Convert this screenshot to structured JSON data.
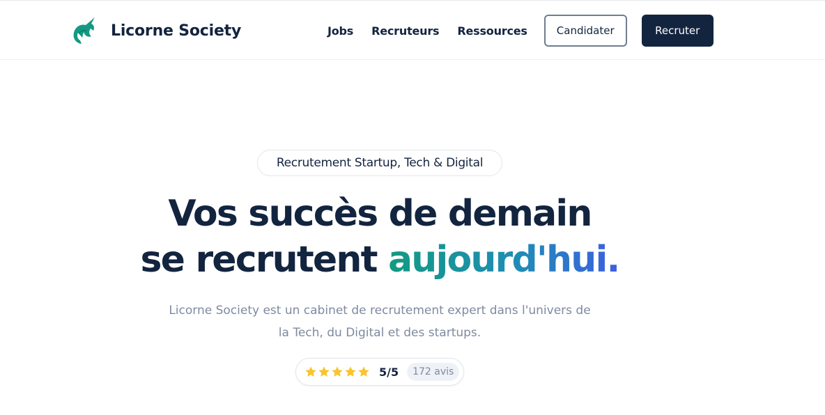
{
  "brand": {
    "name": "Licorne Society",
    "accent_color": "#139a82",
    "dark_color": "#13243f",
    "logo_icon": "unicorn-head-icon"
  },
  "nav": {
    "items": [
      {
        "label": "Jobs"
      },
      {
        "label": "Recruteurs"
      },
      {
        "label": "Ressources"
      }
    ],
    "candidate_button": "Candidater",
    "recruit_button": "Recruter"
  },
  "hero": {
    "badge": "Recrutement Startup, Tech & Digital",
    "title_line1": "Vos succès de demain",
    "title_line2_prefix": "se recrutent ",
    "title_highlight": "aujourd'hui.",
    "subtitle": "Licorne Society est un cabinet de recrutement expert dans l'univers de la Tech, du Digital et des startups."
  },
  "rating": {
    "stars": 5,
    "max_stars": 5,
    "star_color": "#f9c42f",
    "score": "5/5",
    "reviews": "172 avis"
  }
}
